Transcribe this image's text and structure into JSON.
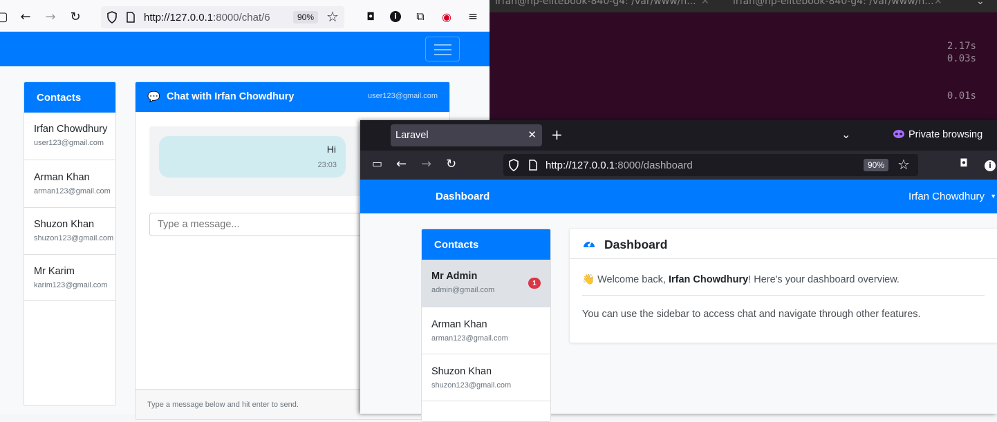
{
  "back_browser": {
    "url_host": "http://127.0.0.1",
    "url_rest": ":8000/chat/6",
    "zoom": "90%",
    "chat": {
      "contacts_title": "Contacts",
      "contacts": [
        {
          "name": "Irfan Chowdhury",
          "email": "user123@gmail.com"
        },
        {
          "name": "Arman Khan",
          "email": "arman123@gmail.com"
        },
        {
          "name": "Shuzon Khan",
          "email": "shuzon123@gmail.com"
        },
        {
          "name": "Mr Karim",
          "email": "karim123@gmail.com"
        }
      ],
      "title": "Chat with Irfan Chowdhury",
      "header_email": "user123@gmail.com",
      "messages": [
        {
          "text": "Hi",
          "time": "23:03"
        }
      ],
      "input_placeholder": "Type a message...",
      "footer_hint": "Type a message below and hit enter to send."
    }
  },
  "terminal": {
    "tabs": [
      "irfan@hp-elitebook-840-g4: /var/www/h...",
      "irfan@hp-elitebook-840-g4: /var/www/h..."
    ],
    "lines": [
      "2.17s",
      "0.03s",
      "0.01s"
    ]
  },
  "front_browser": {
    "tab_title": "Laravel",
    "private_label": "Private browsing",
    "url_host": "http://127.0.0.1",
    "url_rest": ":8000/dashboard",
    "zoom": "90%",
    "app": {
      "brand": "Dashboard",
      "user": "Irfan Chowdhury",
      "contacts_title": "Contacts",
      "contacts": [
        {
          "name": "Mr Admin",
          "email": "admin@gmail.com",
          "badge": "1"
        },
        {
          "name": "Arman Khan",
          "email": "arman123@gmail.com"
        },
        {
          "name": "Shuzon Khan",
          "email": "shuzon123@gmail.com"
        }
      ],
      "dashboard_title": "Dashboard",
      "welcome_prefix": "👋 Welcome back, ",
      "welcome_name": "Irfan Chowdhury",
      "welcome_suffix": "! Here's your dashboard overview.",
      "info": "You can use the sidebar to access chat and navigate through other features."
    }
  },
  "colors": {
    "primary": "#007bff",
    "terminal_bg": "#300a24",
    "danger": "#dc3545"
  }
}
